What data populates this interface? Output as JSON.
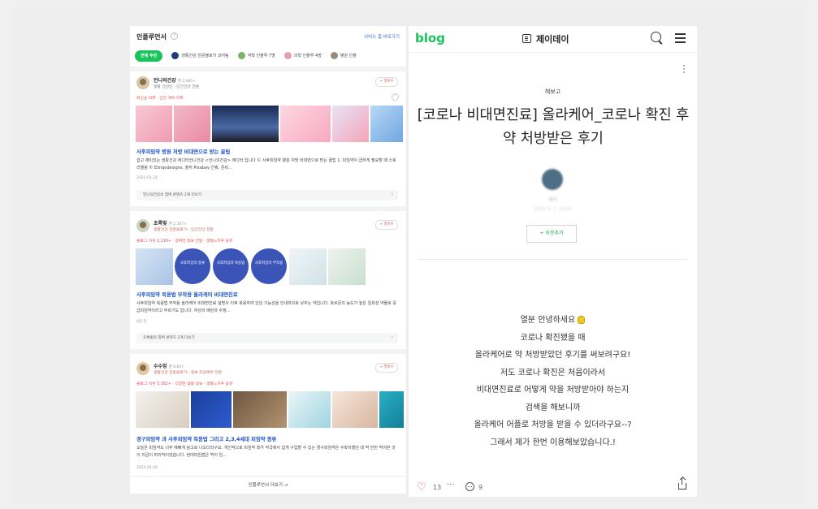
{
  "left": {
    "title": "인플루언서",
    "help_icon": "?",
    "header_link": "서비스 홈 바로가기",
    "tabs": [
      {
        "label": "전체 추천"
      },
      {
        "label": "생활건강 전문블로거 코어팀"
      },
      {
        "label": "약학 인플루 7명"
      },
      {
        "label": "의학 인플루 4명"
      },
      {
        "label": "병원 인플"
      }
    ],
    "cards": [
      {
        "author": "언니의건강",
        "author_suffix": "팬 2,985+",
        "meta": "생활 건강인 · 인간건강 전문",
        "tags": "최신순 리뷰 · 건강 계획 리뷰",
        "follow": "+ 팔로우",
        "title": "사후피임약 병원 처방 비대면으로 받는 꿀팁",
        "snippet": "쉽고 재미있는 생활건강 에디터언니건강 <언니의건강> 에디터 입니다 © 사후피임약 병원 처방 비대면으로 받는 꿀팁 1. 피임약이 급하게 필요할 때 스토리텔링 © Elinqodesigns, 출처 Pixabay 간혹, 준비...",
        "date": "2022.03.14.",
        "related": "언니의건강의 참여 콘텐츠 2개 더보기"
      },
      {
        "author": "초록빛",
        "author_suffix": "팬 2,307+",
        "meta": "생활건강 전문블로거 · 인간건강 전문",
        "tags": "블로그 이웃 2,216+ · 정확한 정보 전달 · 생필느끼우 공유",
        "follow": "+ 팔로우",
        "title": "사후피임약 복용법 부작용 올라케어 비대면진료",
        "snippet": "사후피임약 복용법 부작용 올라케어 비대면진료 설명서 이후 복용하여 있던 기능성을 안내하므로 낮추는 약입니다. 호르몬의 농도가 높은 일회성 약물로 응급피임약이라고 부르기도 합니다. 여성의 배란과 수정...",
        "date": "6일 전",
        "related": "초록빛의 참여 콘텐츠 2개 더보기",
        "circle_labels": [
          "사후피임약 종류",
          "사후피임약 복용법",
          "사후피임약 부작용"
        ]
      },
      {
        "author": "수수밍",
        "author_suffix": "팬 8,837",
        "meta": "생활건강 전문블로거 · 정보 지원에버 전문",
        "tags": "블로그 이웃 5,182+ · 다양한 생활 정보 · 생필느끼우 공유",
        "follow": "+ 팔로우",
        "title": "경구피임약 과 사후피임약 복용법 그리고 2,3,4세대 피임약 종류",
        "snippet": "오늘은 피임약도 너무 예뻐게 광고로 나오더라구요. 개인적으로 피임약 최극 약국에서 쉽게 구입할 수 있는 경구피임약은 수락이했던 데 딱 한번 먹어본 것이 지금이 피지막이었습니다. 현대피임법은 먹어 임...",
        "date": "2022.05.16."
      }
    ],
    "more": "인플루언서 더보기 →"
  },
  "right": {
    "logo": "blog",
    "blog_name": "제이데이",
    "category": "해보고",
    "headline": "[코로나 비대면진료] 올라케어_코로나 확진 후 약 처방받은 후기",
    "writer": "제이",
    "writer_date": "2022. 4. 7. 19:07",
    "neighbor_btn": "+ 이웃추가",
    "body_lines": [
      "열분 안녕하세요",
      "코로나 확진됐을 때",
      "올라케어로 약 처방받았던 후기를 써보려구요!",
      "저도 코로나 확진은 처음이라서",
      "비대면진료로 어떻게 약을 처방받아야 하는지",
      "검색을 해보니까",
      "올라케어 어플로 처방을 받을 수 있더라구요--?",
      "그래서 제가 한번 이용해보았습니다.!"
    ],
    "like_count": "13",
    "comment_count": "9",
    "more_dots": "···"
  },
  "colors": {
    "brand_green": "#19c45a",
    "link_blue": "#1a4fc6",
    "accent_red": "#e05050",
    "circle_blue": "#3b54b8"
  }
}
